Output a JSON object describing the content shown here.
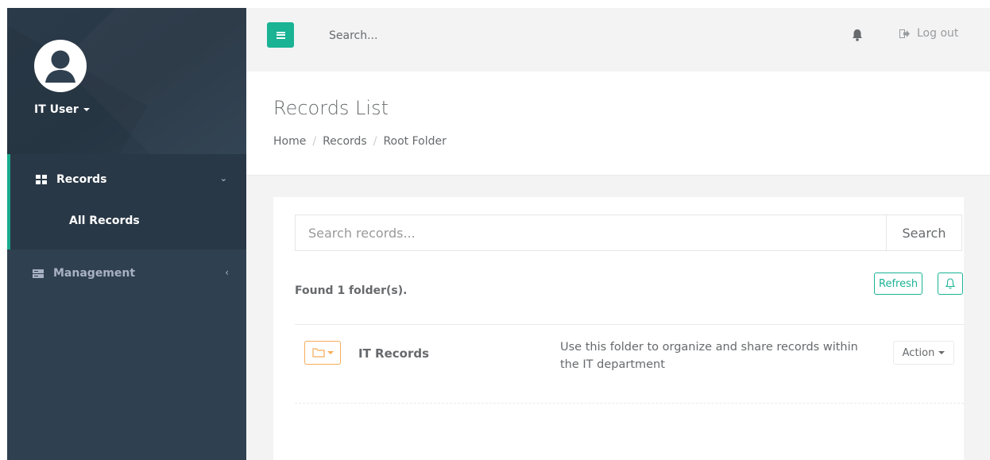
{
  "sidebar": {
    "user_name": "IT User",
    "nav": {
      "records_label": "Records",
      "records_sub": "All Records",
      "management_label": "Management"
    }
  },
  "topbar": {
    "search_placeholder": "Search...",
    "logout_label": "Log out"
  },
  "heading": {
    "title": "Records List",
    "breadcrumb": [
      "Home",
      "Records",
      "Root Folder"
    ]
  },
  "content": {
    "search_placeholder": "Search records...",
    "search_button": "Search",
    "found_text": "Found 1 folder(s).",
    "refresh_label": "Refresh",
    "folders": [
      {
        "name": "IT Records",
        "description": "Use this folder to organize and share records within the IT department",
        "action_label": "Action"
      }
    ]
  },
  "colors": {
    "accent": "#1ab394",
    "sidebar_bg": "#2f4050",
    "folder_warning": "#f8ac59"
  }
}
